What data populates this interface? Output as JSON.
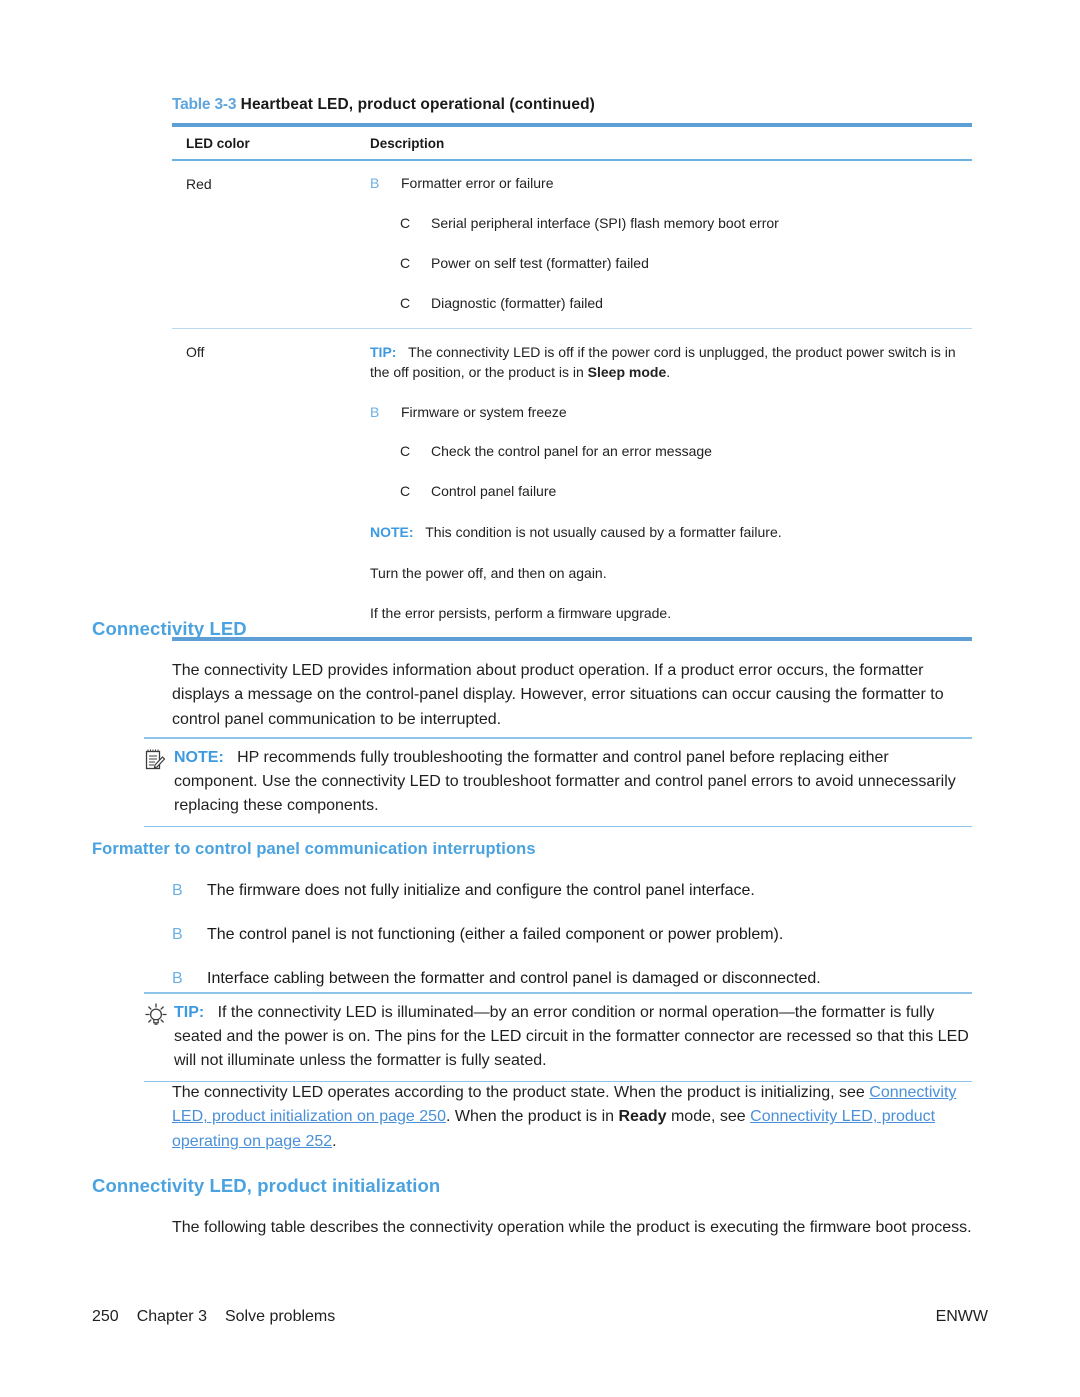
{
  "table": {
    "caption_number": "Table 3-3",
    "caption_title": "Heartbeat LED, product operational (continued)",
    "headers": [
      "LED color",
      "Description"
    ],
    "rows": [
      {
        "led_color": "Red",
        "items": [
          {
            "marker": "B",
            "level": 1,
            "text": "Formatter error or failure"
          },
          {
            "marker": "C",
            "level": 2,
            "text": "Serial peripheral interface (SPI) flash memory boot error"
          },
          {
            "marker": "C",
            "level": 2,
            "text": "Power on self test (formatter) failed"
          },
          {
            "marker": "C",
            "level": 2,
            "text": "Diagnostic (formatter) failed"
          }
        ]
      },
      {
        "led_color": "Off",
        "tip_label": "TIP:",
        "tip_text_a": "The connectivity LED is off if the power cord is unplugged, the product power switch is in the off position, or the product is in ",
        "tip_bold": "Sleep mode",
        "tip_text_b": ".",
        "items": [
          {
            "marker": "B",
            "level": 1,
            "text": "Firmware or system freeze"
          },
          {
            "marker": "C",
            "level": 2,
            "text": "Check the control panel for an error message"
          },
          {
            "marker": "C",
            "level": 2,
            "text": "Control panel failure"
          }
        ],
        "note_label": "NOTE:",
        "note_text": "This condition is not usually caused by a formatter failure.",
        "after_note_1": "Turn the power off, and then on again.",
        "after_note_2": "If the error persists, perform a firmware upgrade."
      }
    ]
  },
  "section": {
    "heading": "Connectivity LED",
    "intro": "The connectivity LED provides information about product operation. If a product error occurs, the formatter displays a message on the control-panel display. However, error situations can occur causing the formatter to control panel communication to be interrupted.",
    "note_callout": {
      "icon": "note-icon",
      "label": "NOTE:",
      "text": "HP recommends fully troubleshooting the formatter and control panel before replacing either component. Use the connectivity LED to troubleshoot formatter and control panel errors to avoid unnecessarily replacing these components."
    },
    "subheading": "Formatter to control panel communication interruptions",
    "bullets": [
      {
        "marker": "B",
        "text": "The firmware does not fully initialize and configure the control panel interface."
      },
      {
        "marker": "B",
        "text": "The control panel is not functioning (either a failed component or power problem)."
      },
      {
        "marker": "B",
        "text": "Interface cabling between the formatter and control panel is damaged or disconnected."
      }
    ],
    "tip_callout": {
      "icon": "tip-lightbulb-icon",
      "label": "TIP:",
      "text": "If the connectivity LED is illuminated—by an error condition or normal operation—the formatter is fully seated and the power is on. The pins for the LED circuit in the formatter connector are recessed so that this LED will not illuminate unless the formatter is fully seated."
    },
    "xref_para": {
      "part1": "The connectivity LED operates according to the product state. When the product is initializing, see ",
      "link1": "Connectivity LED, product initialization on page 250",
      "part2": ". When the product is in ",
      "bold1": "Ready",
      "part3": " mode, see ",
      "link2": "Connectivity LED, product operating on page 252",
      "part4": "."
    }
  },
  "section2": {
    "heading": "Connectivity LED, product initialization",
    "body": "The following table describes the connectivity operation while the product is executing the firmware boot process."
  },
  "footer": {
    "page_number": "250",
    "chapter": "Chapter 3",
    "chapter_title": "Solve problems",
    "right": "ENWW"
  },
  "colors": {
    "heading_blue": "#4aa3e0",
    "rule_blue": "#5e9fd6",
    "rule_light_blue": "#b9d9ef",
    "link_blue": "#4a90d9",
    "marker_blue": "#6cb0e4"
  }
}
